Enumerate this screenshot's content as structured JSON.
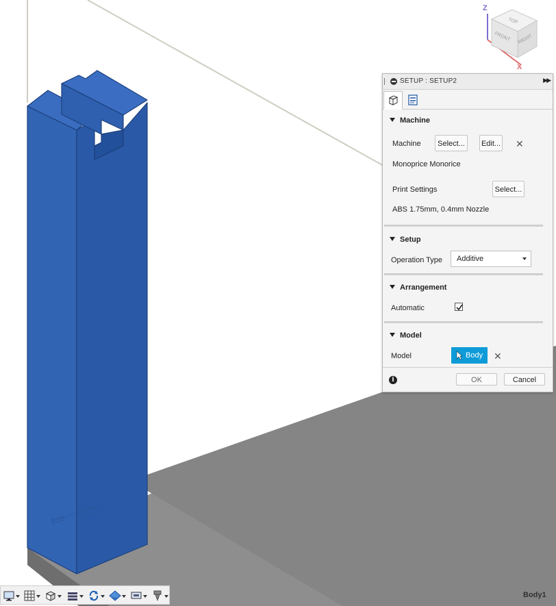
{
  "viewcube": {
    "top": "TOP",
    "front": "FRONT",
    "right": "RIGHT",
    "z_axis": "Z",
    "x_axis": "X"
  },
  "setup_panel": {
    "title": "SETUP : SETUP2",
    "machine_section": {
      "heading": "Machine",
      "machine_label": "Machine",
      "select_label": "Select...",
      "edit_label": "Edit...",
      "machine_name": "Monoprice Monorice",
      "print_settings_label": "Print Settings",
      "print_select_label": "Select...",
      "print_settings_value": "ABS 1.75mm, 0.4mm Nozzle"
    },
    "setup_section": {
      "heading": "Setup",
      "operation_type_label": "Operation Type",
      "operation_type_value": "Additive"
    },
    "arrangement_section": {
      "heading": "Arrangement",
      "automatic_label": "Automatic",
      "automatic_checked": true
    },
    "model_section": {
      "heading": "Model",
      "model_label": "Model",
      "body_button": "Body"
    },
    "ok_label": "OK",
    "cancel_label": "Cancel"
  },
  "status": {
    "selected_body": "Body1"
  },
  "colors": {
    "part_blue": "#2d5fae",
    "selection_blue": "#0e9bd8",
    "bed_gray": "#8e8e8e"
  }
}
